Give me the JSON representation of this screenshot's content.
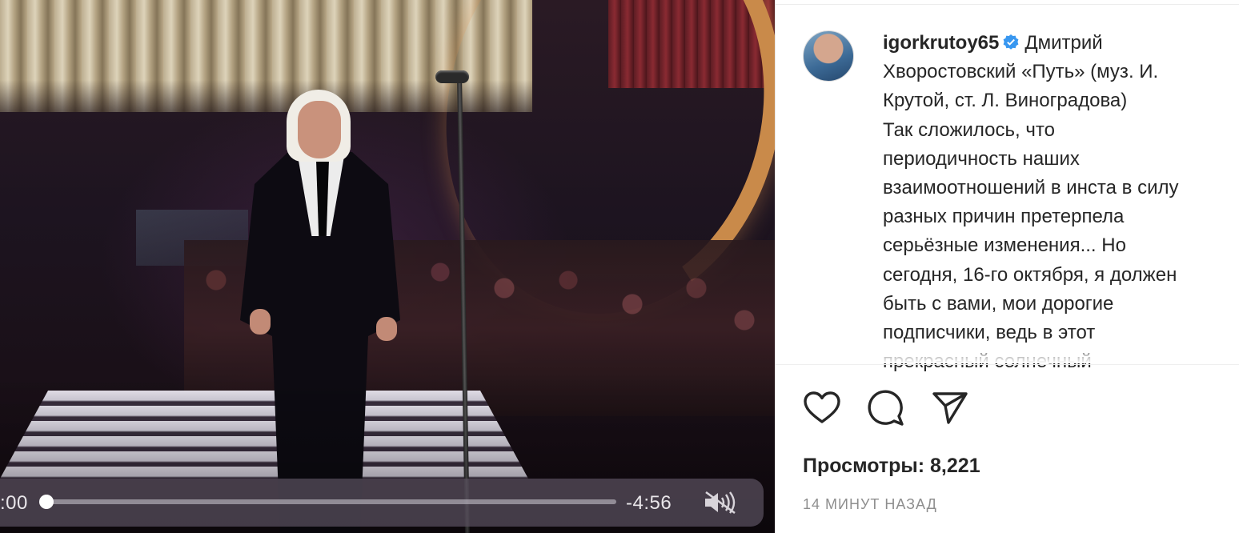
{
  "video": {
    "current_time": ":00",
    "remaining_time": "-4:56",
    "progress": 0.0,
    "muted": true
  },
  "post": {
    "username": "igorkrutoy65",
    "verified": true,
    "caption_lines": [
      "Дмитрий",
      "Хворостовский «Путь» (муз. И.",
      "Крутой, ст. Л. Виноградова)",
      "Так сложилось, что",
      "периодичность наших",
      "взаимоотношений в инста в силу",
      "разных причин претерпела",
      "серьёзные изменения... Но",
      "сегодня, 16-го октября, я должен",
      "быть с вами, мои дорогие",
      "подписчики, ведь в этот",
      "прекрасный солнечный"
    ],
    "views_label": "Просмотры: 8,221",
    "timestamp": "14 МИНУТ НАЗАД"
  },
  "actions": {
    "like_icon": "heart-icon",
    "comment_icon": "comment-icon",
    "share_icon": "send-icon"
  },
  "colors": {
    "text": "#262626",
    "muted": "#8e8e8e",
    "verified": "#3897f0"
  }
}
